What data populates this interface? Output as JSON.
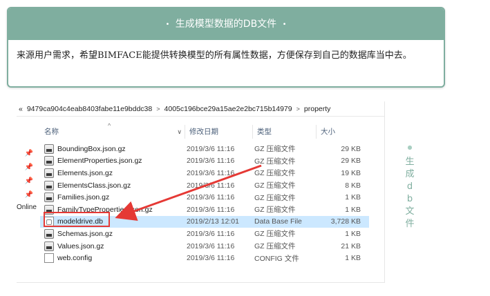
{
  "card": {
    "title": "生成模型数据的DB文件",
    "bullet": "•",
    "body": "来源用户需求，希望BIMFACE能提供转换模型的所有属性数据，方便保存到自己的数据库当中去。"
  },
  "explorer": {
    "breadcrumb": [
      "«",
      "9479ca904c4eab8403fabe11e9bddc38",
      "4005c196bce29a15ae2e2bc715b14979",
      "property"
    ],
    "breadcrumb_sep": ">",
    "columns": {
      "name": "名称",
      "date": "修改日期",
      "type": "类型",
      "size": "大小"
    },
    "sort_arrow": "^",
    "chevron": "∨",
    "side_label": "Online",
    "pin_glyph": "📌",
    "files": [
      {
        "name": "BoundingBox.json.gz",
        "date": "2019/3/6 11:16",
        "type": "GZ 压缩文件",
        "size": "29 KB",
        "icon": "gz-archive-icon"
      },
      {
        "name": "ElementProperties.json.gz",
        "date": "2019/3/6 11:16",
        "type": "GZ 压缩文件",
        "size": "29 KB",
        "icon": "gz-archive-icon"
      },
      {
        "name": "Elements.json.gz",
        "date": "2019/3/6 11:16",
        "type": "GZ 压缩文件",
        "size": "19 KB",
        "icon": "gz-archive-icon"
      },
      {
        "name": "ElementsClass.json.gz",
        "date": "2019/3/6 11:16",
        "type": "GZ 压缩文件",
        "size": "8 KB",
        "icon": "gz-archive-icon"
      },
      {
        "name": "Families.json.gz",
        "date": "2019/3/6 11:16",
        "type": "GZ 压缩文件",
        "size": "1 KB",
        "icon": "gz-archive-icon"
      },
      {
        "name": "FamilyTypeProperties.json.gz",
        "date": "2019/3/6 11:16",
        "type": "GZ 压缩文件",
        "size": "1 KB",
        "icon": "gz-archive-icon"
      },
      {
        "name": "modeldrive.db",
        "date": "2019/2/13 12:01",
        "type": "Data Base File",
        "size": "3,728 KB",
        "icon": "database-file-icon",
        "selected": true
      },
      {
        "name": "Schemas.json.gz",
        "date": "2019/3/6 11:16",
        "type": "GZ 压缩文件",
        "size": "1 KB",
        "icon": "gz-archive-icon"
      },
      {
        "name": "Values.json.gz",
        "date": "2019/3/6 11:16",
        "type": "GZ 压缩文件",
        "size": "21 KB",
        "icon": "gz-archive-icon"
      },
      {
        "name": "web.config",
        "date": "2019/3/6 11:16",
        "type": "CONFIG 文件",
        "size": "1 KB",
        "icon": "config-file-icon"
      }
    ]
  },
  "side_caption": {
    "dot": "●",
    "chars": [
      "生",
      "成",
      "d",
      "b",
      "文",
      "件"
    ]
  },
  "colors": {
    "accent": "#7fae9f",
    "highlight": "#e53935",
    "selected_row": "#cce8ff"
  }
}
